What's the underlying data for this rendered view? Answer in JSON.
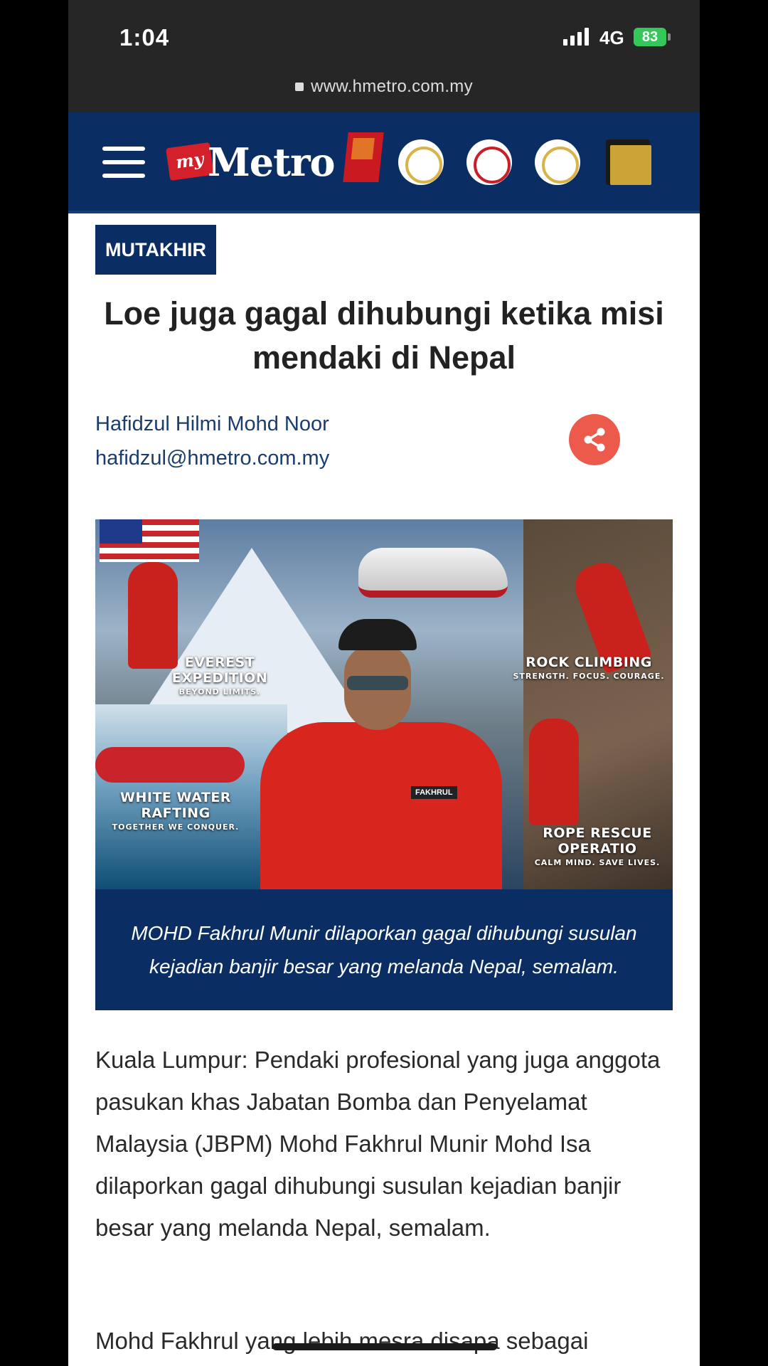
{
  "status_bar": {
    "time": "1:04",
    "network": "4G",
    "battery": "83"
  },
  "browser": {
    "url": "www.hmetro.com.my"
  },
  "site": {
    "logo_prefix": "my",
    "logo_name": "Metro"
  },
  "article": {
    "category": "MUTAKHIR",
    "headline": "Loe juga gagal dihubungi ketika misi mendaki di Nepal",
    "author_name": "Hafidzul Hilmi Mohd Noor",
    "author_email": "hafidzul@hmetro.com.my",
    "image": {
      "labels": [
        {
          "title": "EVEREST EXPEDITION",
          "subtitle": "BEYOND LIMITS."
        },
        {
          "title": "ROCK CLIMBING",
          "subtitle": "STRENGTH. FOCUS. COURAGE."
        },
        {
          "title": "WHITE WATER RAFTING",
          "subtitle": "TOGETHER WE CONQUER."
        },
        {
          "title": "ROPE RESCUE OPERATIO",
          "subtitle": "CALM MIND. SAVE LIVES."
        }
      ],
      "badge_text": "FAKHRUL"
    },
    "caption": "MOHD Fakhrul Munir dilaporkan gagal dihubungi susulan kejadian banjir besar yang melanda Nepal, semalam.",
    "paragraphs": [
      "Kuala Lumpur: Pendaki profesional yang juga anggota pasukan khas Jabatan Bomba dan Penyelamat Malaysia (JBPM) Mohd Fakhrul Munir Mohd Isa dilaporkan gagal dihubungi susulan kejadian banjir besar yang melanda Nepal, semalam.",
      "Mohd Fakhrul yang lebih mesra disapa sebagai"
    ]
  },
  "colors": {
    "brand_navy": "#0a2e63",
    "share_red": "#ec5a4c",
    "battery_green": "#34c759"
  },
  "icons": [
    "menu-icon",
    "lock-icon",
    "share-icon",
    "signal-icon",
    "battery-icon"
  ]
}
